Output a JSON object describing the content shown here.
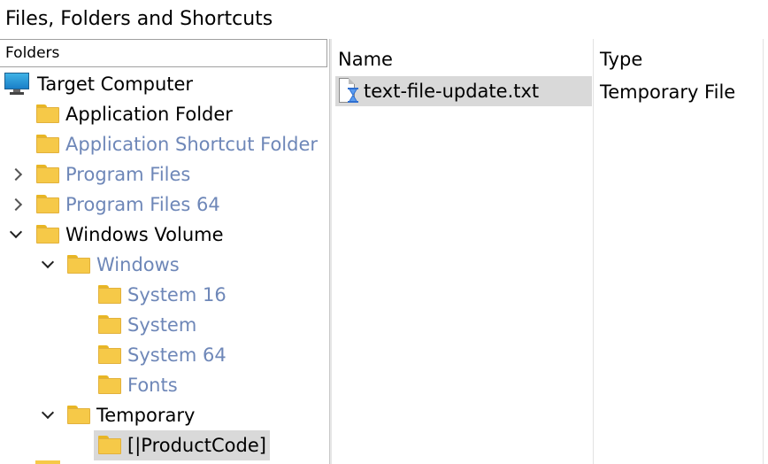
{
  "window": {
    "title": "Files, Folders and Shortcuts"
  },
  "left_panel": {
    "header": "Folders",
    "tree": [
      {
        "label": "Target Computer",
        "icon": "computer-icon",
        "expander": "none",
        "dim": false,
        "selected": false
      },
      {
        "label": "Application Folder",
        "icon": "folder-icon",
        "expander": "none",
        "dim": false,
        "selected": false
      },
      {
        "label": "Application Shortcut Folder",
        "icon": "folder-icon",
        "expander": "none",
        "dim": true,
        "selected": false
      },
      {
        "label": "Program Files",
        "icon": "folder-icon",
        "expander": "collapsed",
        "dim": true,
        "selected": false
      },
      {
        "label": "Program Files 64",
        "icon": "folder-icon",
        "expander": "collapsed",
        "dim": true,
        "selected": false
      },
      {
        "label": "Windows Volume",
        "icon": "folder-icon",
        "expander": "expanded",
        "dim": false,
        "selected": false
      },
      {
        "label": "Windows",
        "icon": "folder-icon",
        "expander": "expanded",
        "dim": true,
        "selected": false
      },
      {
        "label": "System 16",
        "icon": "folder-icon",
        "expander": "none",
        "dim": true,
        "selected": false
      },
      {
        "label": "System",
        "icon": "folder-icon",
        "expander": "none",
        "dim": true,
        "selected": false
      },
      {
        "label": "System 64",
        "icon": "folder-icon",
        "expander": "none",
        "dim": true,
        "selected": false
      },
      {
        "label": "Fonts",
        "icon": "folder-icon",
        "expander": "none",
        "dim": true,
        "selected": false
      },
      {
        "label": "Temporary",
        "icon": "folder-icon",
        "expander": "expanded",
        "dim": false,
        "selected": false
      },
      {
        "label": "[|ProductCode]",
        "icon": "folder-icon",
        "expander": "none",
        "dim": false,
        "selected": true
      }
    ]
  },
  "right_panel": {
    "columns": {
      "name": "Name",
      "type": "Type"
    },
    "files": [
      {
        "name": "text-file-update.txt",
        "type": "Temporary File",
        "icon": "temporary-file-icon",
        "selected": true
      }
    ]
  },
  "colors": {
    "dim_text": "#6e87b8",
    "selection": "#d9d9d9",
    "folder": "#f6c948"
  }
}
